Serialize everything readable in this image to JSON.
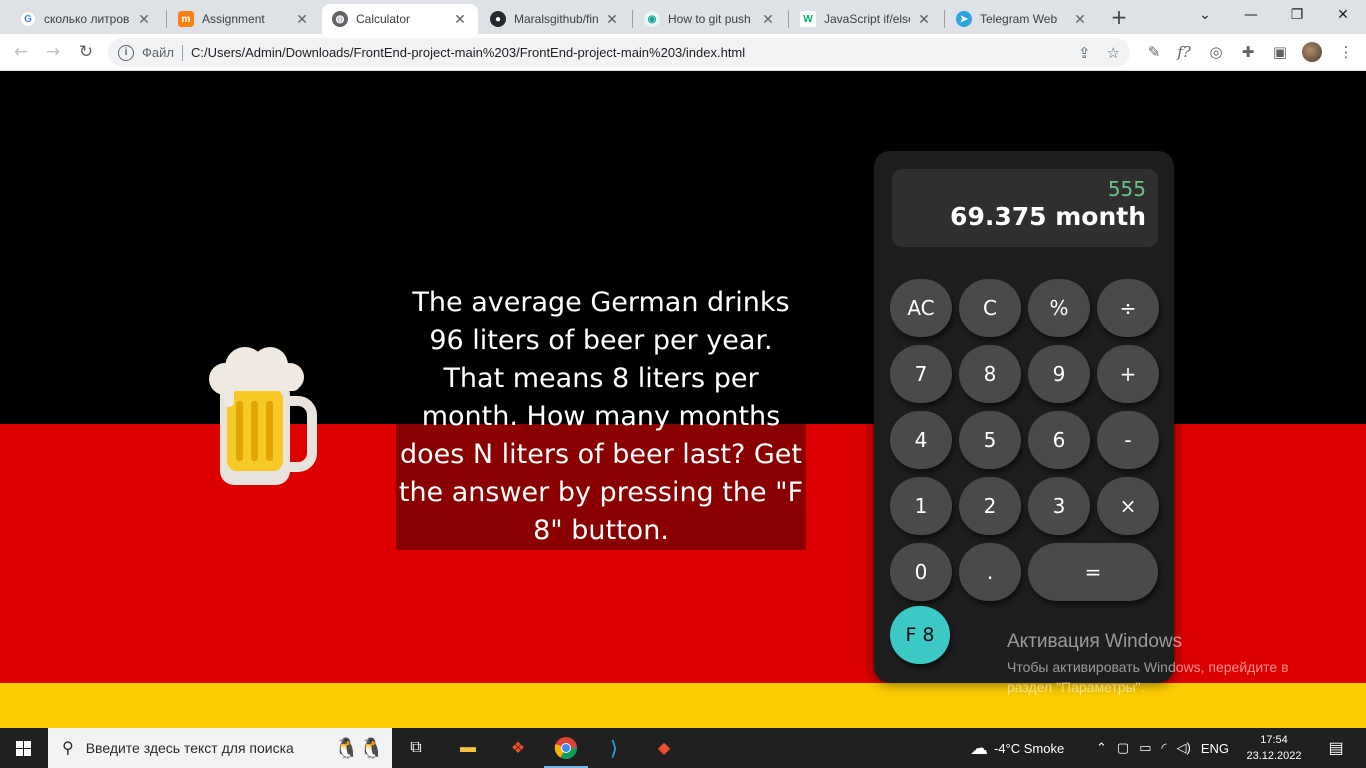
{
  "browser": {
    "tabs": [
      {
        "label": "сколько литров",
        "icon": "google-icon",
        "active": false
      },
      {
        "label": "Assignment",
        "icon": "moodle-icon",
        "active": false
      },
      {
        "label": "Calculator",
        "icon": "globe-icon",
        "active": true
      },
      {
        "label": "Maralsgithub/fin",
        "icon": "github-icon",
        "active": false
      },
      {
        "label": "How to git push",
        "icon": "eye-icon",
        "active": false
      },
      {
        "label": "JavaScript if/else",
        "icon": "w3schools-icon",
        "active": false
      },
      {
        "label": "Telegram Web",
        "icon": "telegram-icon",
        "active": false
      }
    ],
    "address": {
      "scheme_label": "Файл",
      "url": "C:/Users/Admin/Downloads/FrontEnd-project-main%203/FrontEnd-project-main%203/index.html"
    }
  },
  "page": {
    "question": "The average German drinks 96 liters of beer per year. That means 8 liters per month. How many months does N liters of beer last? Get the answer by pressing the \"F 8\" button.",
    "flag_colors": {
      "black": "#000000",
      "red": "#dd0000",
      "gold": "#ffce00"
    },
    "calculator": {
      "previous": "555",
      "current": "69.375 month",
      "keys": {
        "ac": "AC",
        "c": "C",
        "percent": "%",
        "divide": "÷",
        "seven": "7",
        "eight": "8",
        "nine": "9",
        "plus": "+",
        "four": "4",
        "five": "5",
        "six": "6",
        "minus": "-",
        "one": "1",
        "two": "2",
        "three": "3",
        "multiply": "×",
        "zero": "0",
        "dot": ".",
        "equals": "=",
        "f8": "F 8"
      },
      "accent_color": "#3cc8c4"
    },
    "watermark": {
      "title": "Активация Windows",
      "line": "Чтобы активировать Windows, перейдите в",
      "line2": "раздел \"Параметры\"."
    }
  },
  "taskbar": {
    "search_placeholder": "Введите здесь текст для поиска",
    "weather": "-4°C  Smoke",
    "lang": "ENG",
    "time": "17:54",
    "date": "23.12.2022"
  }
}
